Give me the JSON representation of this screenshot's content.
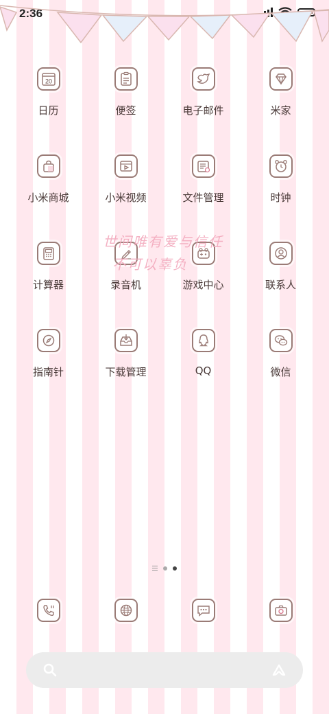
{
  "status_bar": {
    "time": "2:36"
  },
  "watermark": {
    "line1": "世间唯有爱与信任",
    "line2": "不可以辜负"
  },
  "apps": [
    {
      "label": "日历",
      "icon": "calendar-icon",
      "day": "20"
    },
    {
      "label": "便签",
      "icon": "notes-icon"
    },
    {
      "label": "电子邮件",
      "icon": "mail-icon"
    },
    {
      "label": "米家",
      "icon": "mijia-icon"
    },
    {
      "label": "小米商城",
      "icon": "store-icon"
    },
    {
      "label": "小米视频",
      "icon": "video-icon"
    },
    {
      "label": "文件管理",
      "icon": "file-manager-icon"
    },
    {
      "label": "时钟",
      "icon": "clock-icon"
    },
    {
      "label": "计算器",
      "icon": "calculator-icon"
    },
    {
      "label": "录音机",
      "icon": "recorder-icon"
    },
    {
      "label": "游戏中心",
      "icon": "game-center-icon"
    },
    {
      "label": "联系人",
      "icon": "contacts-icon"
    },
    {
      "label": "指南针",
      "icon": "compass-icon"
    },
    {
      "label": "下载管理",
      "icon": "download-icon"
    },
    {
      "label": "QQ",
      "icon": "qq-icon"
    },
    {
      "label": "微信",
      "icon": "wechat-icon"
    }
  ],
  "dock": [
    {
      "icon": "phone-icon"
    },
    {
      "icon": "browser-icon"
    },
    {
      "icon": "messages-icon"
    },
    {
      "icon": "camera-icon"
    }
  ],
  "pager": {
    "pages": 3,
    "active": 3
  },
  "search": {
    "left_icon": "search-icon",
    "right_icon": "assistant-icon"
  },
  "colors": {
    "stripe": "#ffe8ee",
    "icon_stroke": "#9a7b76",
    "label": "#4a3a38",
    "bunting_pink": "#fbe0ee",
    "bunting_blue": "#e6effa"
  }
}
